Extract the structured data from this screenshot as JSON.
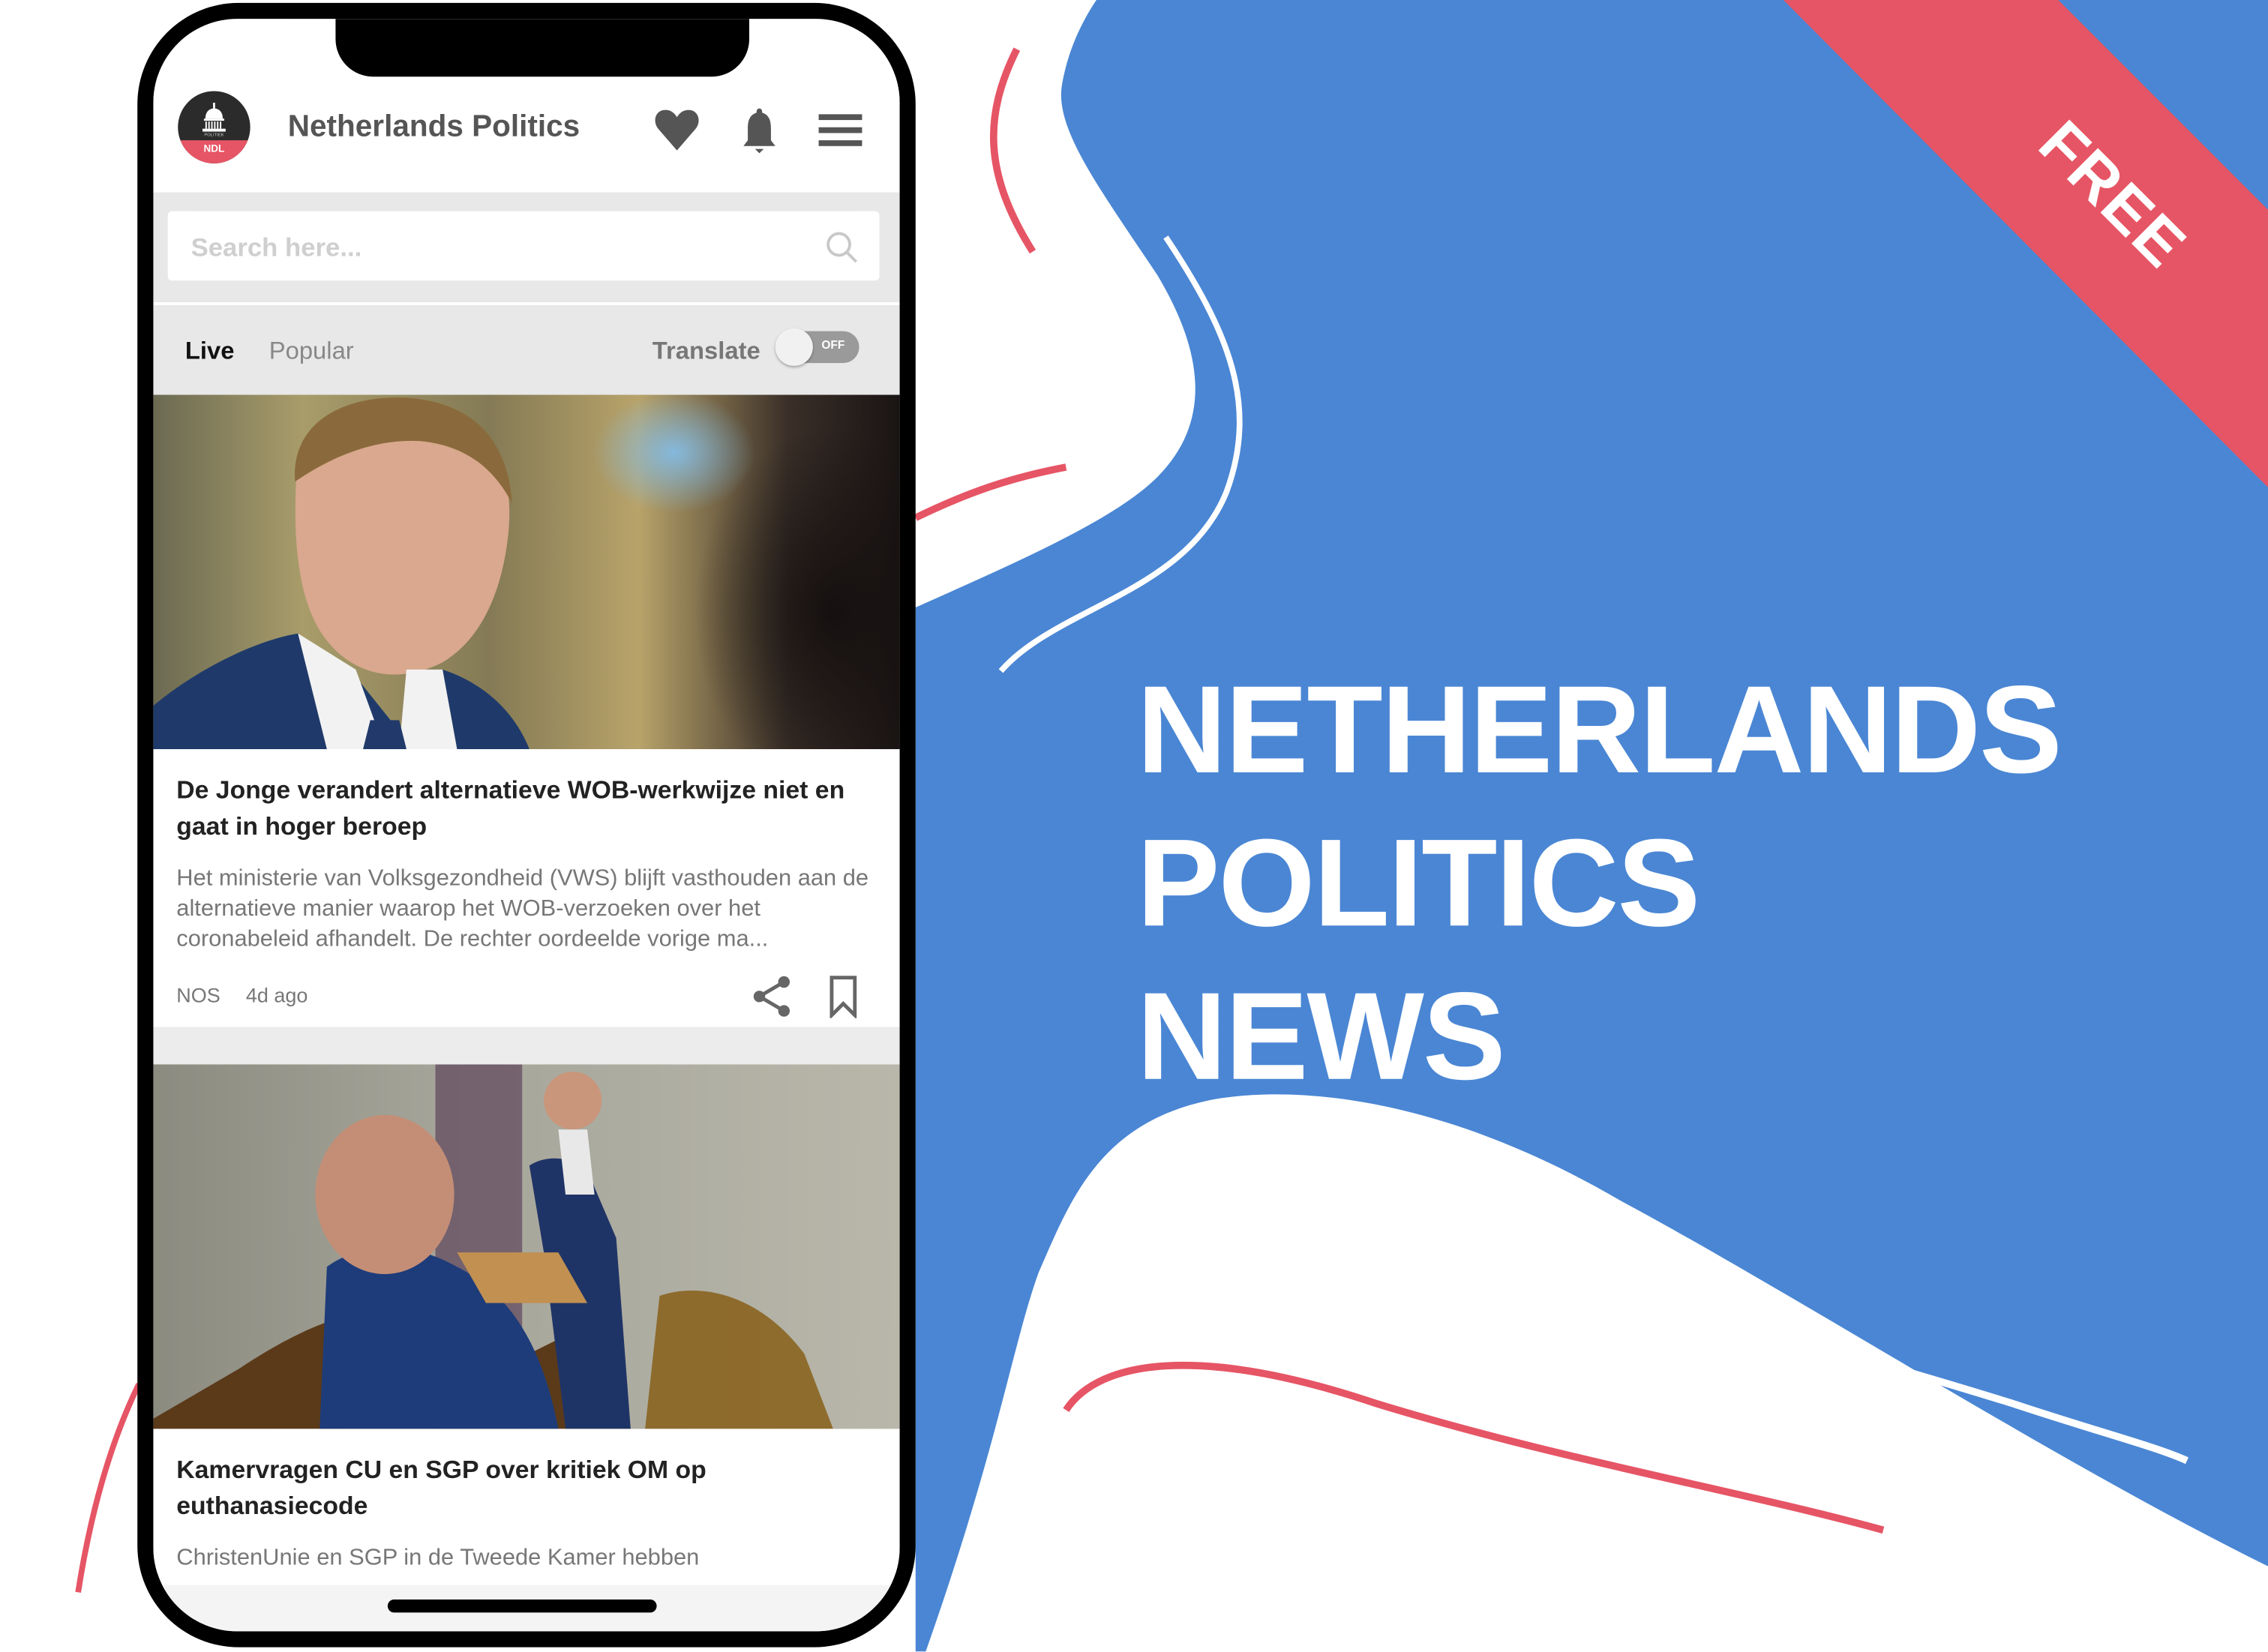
{
  "colors": {
    "brand_blue": "#4A86D4",
    "accent_red": "#E65565",
    "text_dark": "#222222",
    "text_muted": "#777777"
  },
  "promo": {
    "headline_lines": [
      "NETHERLANDS",
      "POLITICS",
      "NEWS"
    ],
    "ribbon_label": "FREE"
  },
  "app": {
    "logo": {
      "badge_text": "NDL",
      "small_text": "POLITIEK",
      "icon": "capitol-dome-icon"
    },
    "title": "Netherlands Politics",
    "header_icons": [
      "heart-icon",
      "bell-icon",
      "hamburger-menu-icon"
    ],
    "search": {
      "placeholder": "Search here...",
      "value": "",
      "icon": "search-icon"
    },
    "tabs": [
      {
        "label": "Live",
        "active": true
      },
      {
        "label": "Popular",
        "active": false
      }
    ],
    "translate": {
      "label": "Translate",
      "state": "OFF"
    },
    "articles": [
      {
        "title": "De Jonge verandert alternatieve WOB-werkwijze niet en gaat in hoger beroep",
        "description": "Het ministerie van Volksgezondheid (VWS) blijft vasthouden aan de alternatieve manier waarop het WOB-verzoeken over het coronabeleid afhandelt. De rechter oordeelde vorige ma...",
        "source": "NOS",
        "time": "4d ago",
        "image": "politician-portrait-photo"
      },
      {
        "title": "Kamervragen CU en SGP over kritiek OM op euthanasiecode",
        "description": "ChristenUnie en SGP in de Tweede Kamer hebben",
        "image": "parliament-debate-photo"
      }
    ]
  }
}
